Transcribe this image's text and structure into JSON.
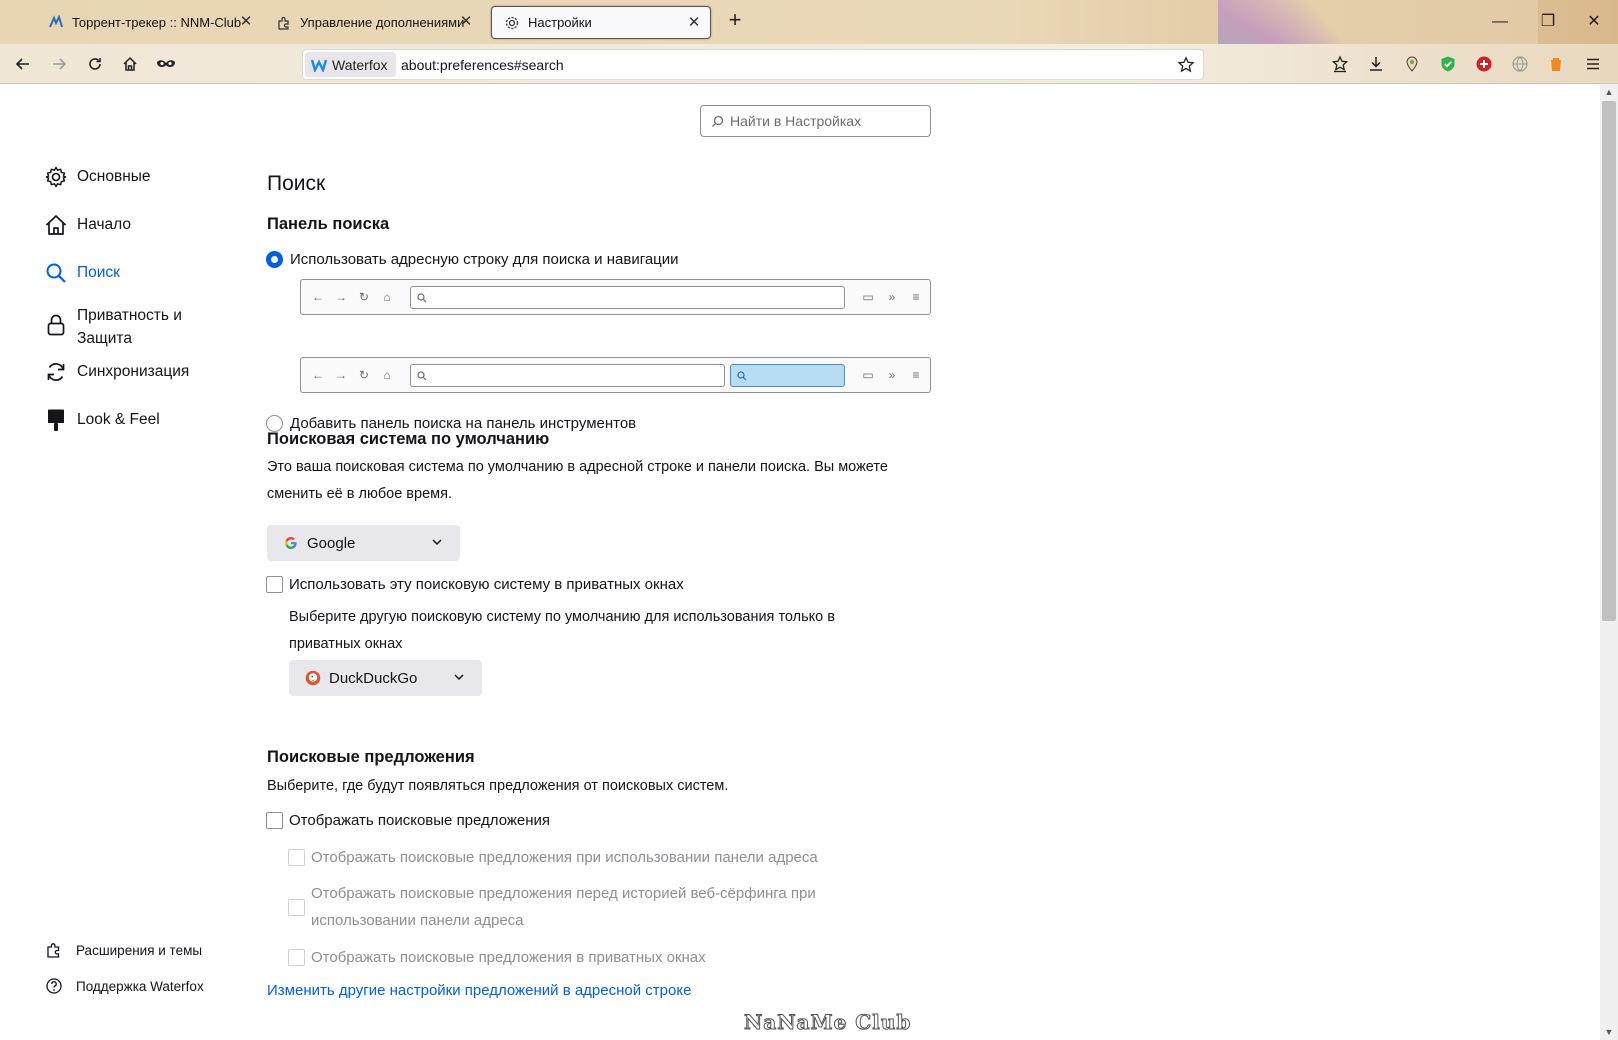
{
  "tabs": [
    {
      "title": "Торрент-трекер :: NNM-Club",
      "icon": "nnm-club-icon"
    },
    {
      "title": "Управление дополнениями",
      "icon": "puzzle-icon"
    },
    {
      "title": "Настройки",
      "icon": "gear-icon",
      "active": true
    }
  ],
  "url_bar": {
    "identity_label": "Waterfox",
    "url": "about:preferences#search"
  },
  "search_prefs_placeholder": "Найти в Настройках",
  "categories": [
    {
      "label": "Основные",
      "icon": "gear-icon"
    },
    {
      "label": "Начало",
      "icon": "home-icon"
    },
    {
      "label": "Поиск",
      "icon": "search-icon",
      "selected": true
    },
    {
      "label": "Приватность и Защита",
      "icon": "lock-icon"
    },
    {
      "label": "Синхронизация",
      "icon": "sync-icon"
    },
    {
      "label": "Look & Feel",
      "icon": "paintbrush-icon"
    }
  ],
  "bottom_links": [
    {
      "label": "Расширения и темы",
      "icon": "puzzle-icon"
    },
    {
      "label": "Поддержка Waterfox",
      "icon": "help-icon"
    }
  ],
  "main": {
    "title": "Поиск",
    "search_bar": {
      "heading": "Панель поиска",
      "option_urlbar": "Использовать адресную строку для поиска и навигации",
      "option_toolbar": "Добавить панель поиска на панель инструментов",
      "selected": "urlbar"
    },
    "default_engine": {
      "heading": "Поисковая система по умолчанию",
      "description": "Это ваша поисковая система по умолчанию в адресной строке и панели поиска. Вы можете сменить её в любое время.",
      "engine": "Google",
      "private_checkbox": "Использовать эту поисковую систему в приватных окнах",
      "private_checked": false,
      "private_description": "Выберите другую поисковую систему по умолчанию для использования только в приватных окнах",
      "private_engine": "DuckDuckGo"
    },
    "suggestions": {
      "heading": "Поисковые предложения",
      "description": "Выберите, где будут появляться предложения от поисковых систем.",
      "show_suggestions": "Отображать поисковые предложения",
      "show_suggestions_checked": false,
      "sub_options": [
        "Отображать поисковые предложения при использовании панели адреса",
        "Отображать поисковые предложения перед историей веб-сёрфинга при использовании панели адреса",
        "Отображать поисковые предложения в приватных окнах"
      ],
      "link": "Изменить другие настройки предложений в адресной строке"
    }
  },
  "watermark": "NaNaMe Club",
  "colors": {
    "accent": "#0061e0",
    "text": "#15141a",
    "disabled": "#8f8f94"
  }
}
